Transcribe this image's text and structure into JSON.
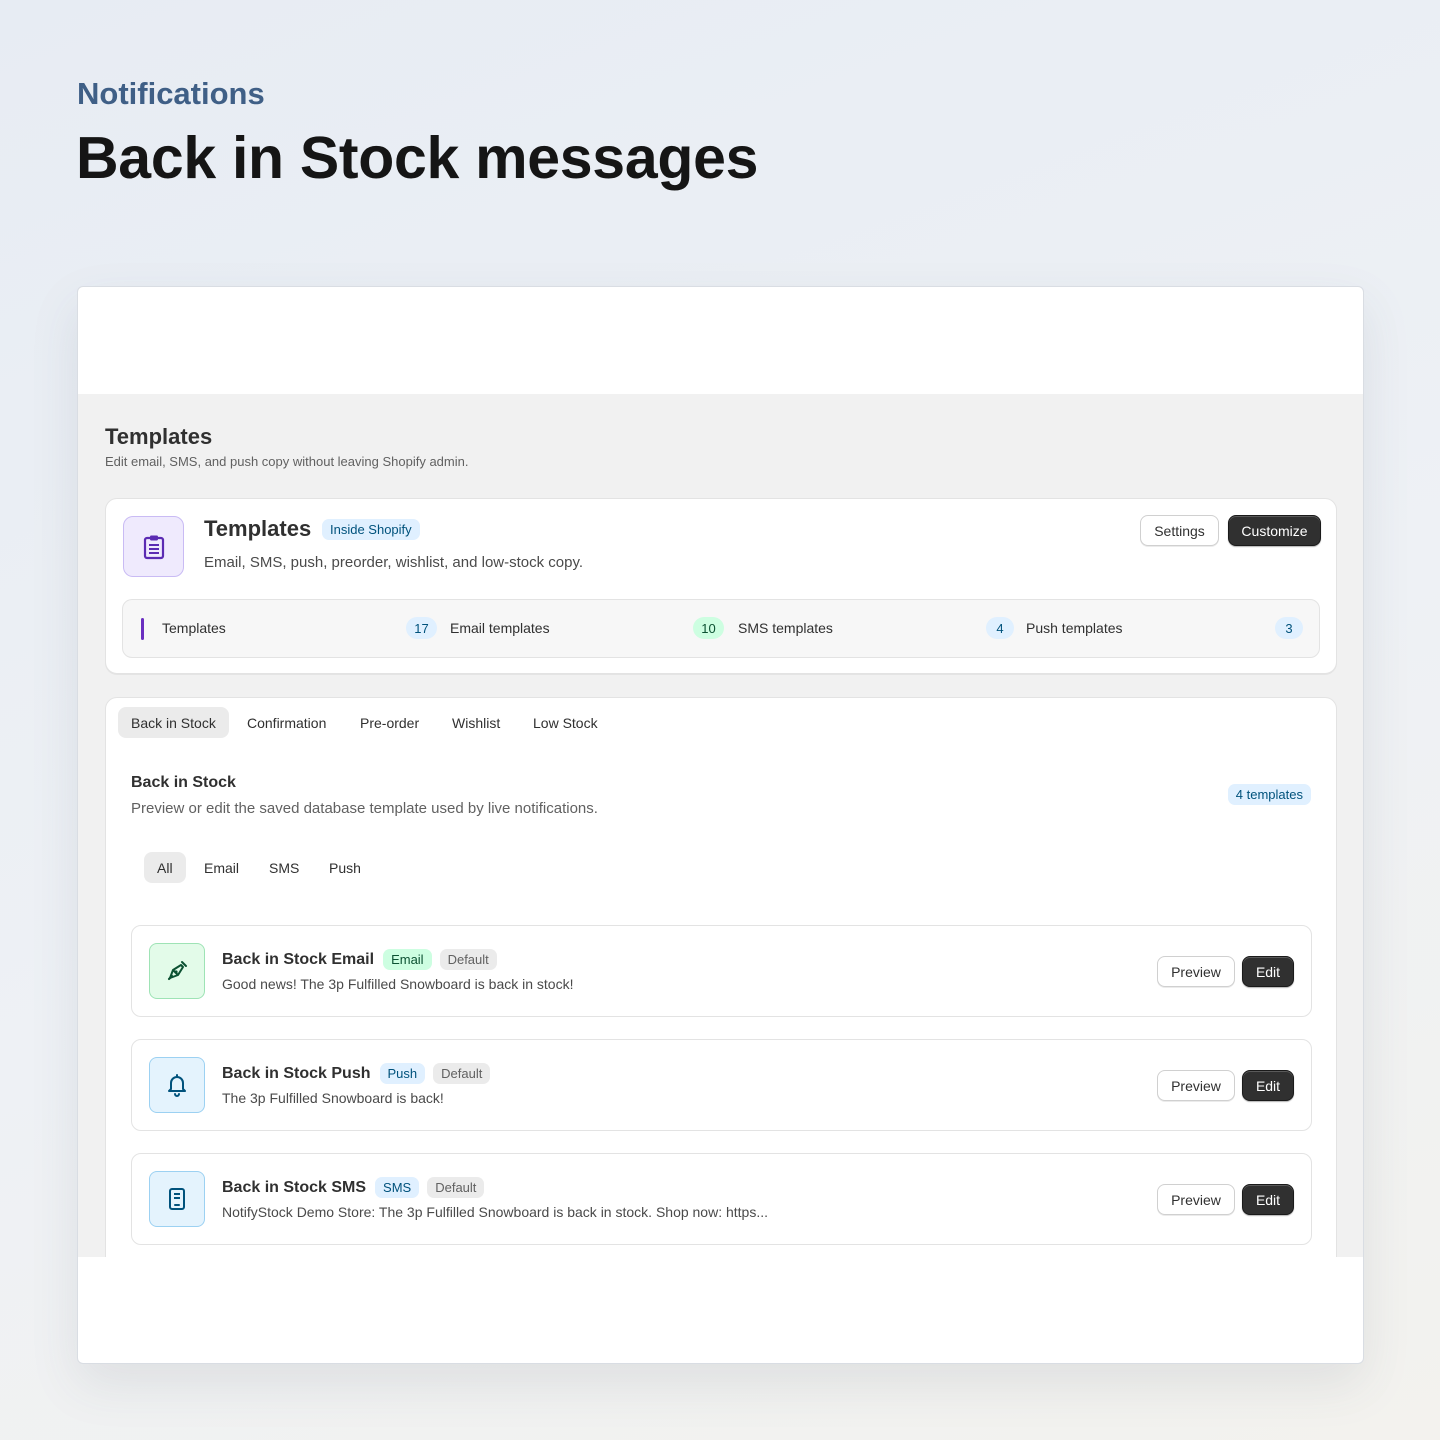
{
  "hero": {
    "eyebrow": "Notifications",
    "headline": "Back in Stock messages"
  },
  "section": {
    "title": "Templates",
    "subtitle": "Edit email, SMS, and push copy without leaving Shopify admin."
  },
  "summary": {
    "icon": "clipboard-icon",
    "title": "Templates",
    "badge": "Inside Shopify",
    "description": "Email, SMS, push, preorder, wishlist, and low-stock copy.",
    "settings_label": "Settings",
    "customize_label": "Customize",
    "stats": [
      {
        "label": "Templates",
        "count": "17"
      },
      {
        "label": "Email templates",
        "count": "10"
      },
      {
        "label": "SMS templates",
        "count": "4"
      },
      {
        "label": "Push templates",
        "count": "3"
      }
    ]
  },
  "tabs": [
    "Back in Stock",
    "Confirmation",
    "Pre-order",
    "Wishlist",
    "Low Stock"
  ],
  "panel": {
    "title": "Back in Stock",
    "subtitle": "Preview or edit the saved database template used by live notifications.",
    "count_badge": "4 templates",
    "filters": [
      "All",
      "Email",
      "SMS",
      "Push"
    ]
  },
  "templates": [
    {
      "icon": "megaphone-icon",
      "name": "Back in Stock Email",
      "channel": "Email",
      "status": "Default",
      "body": "Good news! The 3p Fulfilled Snowboard is back in stock!",
      "preview_label": "Preview",
      "edit_label": "Edit"
    },
    {
      "icon": "bell-icon",
      "name": "Back in Stock Push",
      "channel": "Push",
      "status": "Default",
      "body": "The 3p Fulfilled Snowboard is back!",
      "preview_label": "Preview",
      "edit_label": "Edit"
    },
    {
      "icon": "phone-icon",
      "name": "Back in Stock SMS",
      "channel": "SMS",
      "status": "Default",
      "body": "NotifyStock Demo Store: The 3p Fulfilled Snowboard is back in stock. Shop now: https...",
      "preview_label": "Preview",
      "edit_label": "Edit"
    }
  ],
  "colors": {
    "eyebrow": "#3f5f86",
    "accent": "#6a2fc0",
    "primary_button": "#303030",
    "info_badge": "#e0f0ff",
    "success_badge": "#cdfee1"
  }
}
